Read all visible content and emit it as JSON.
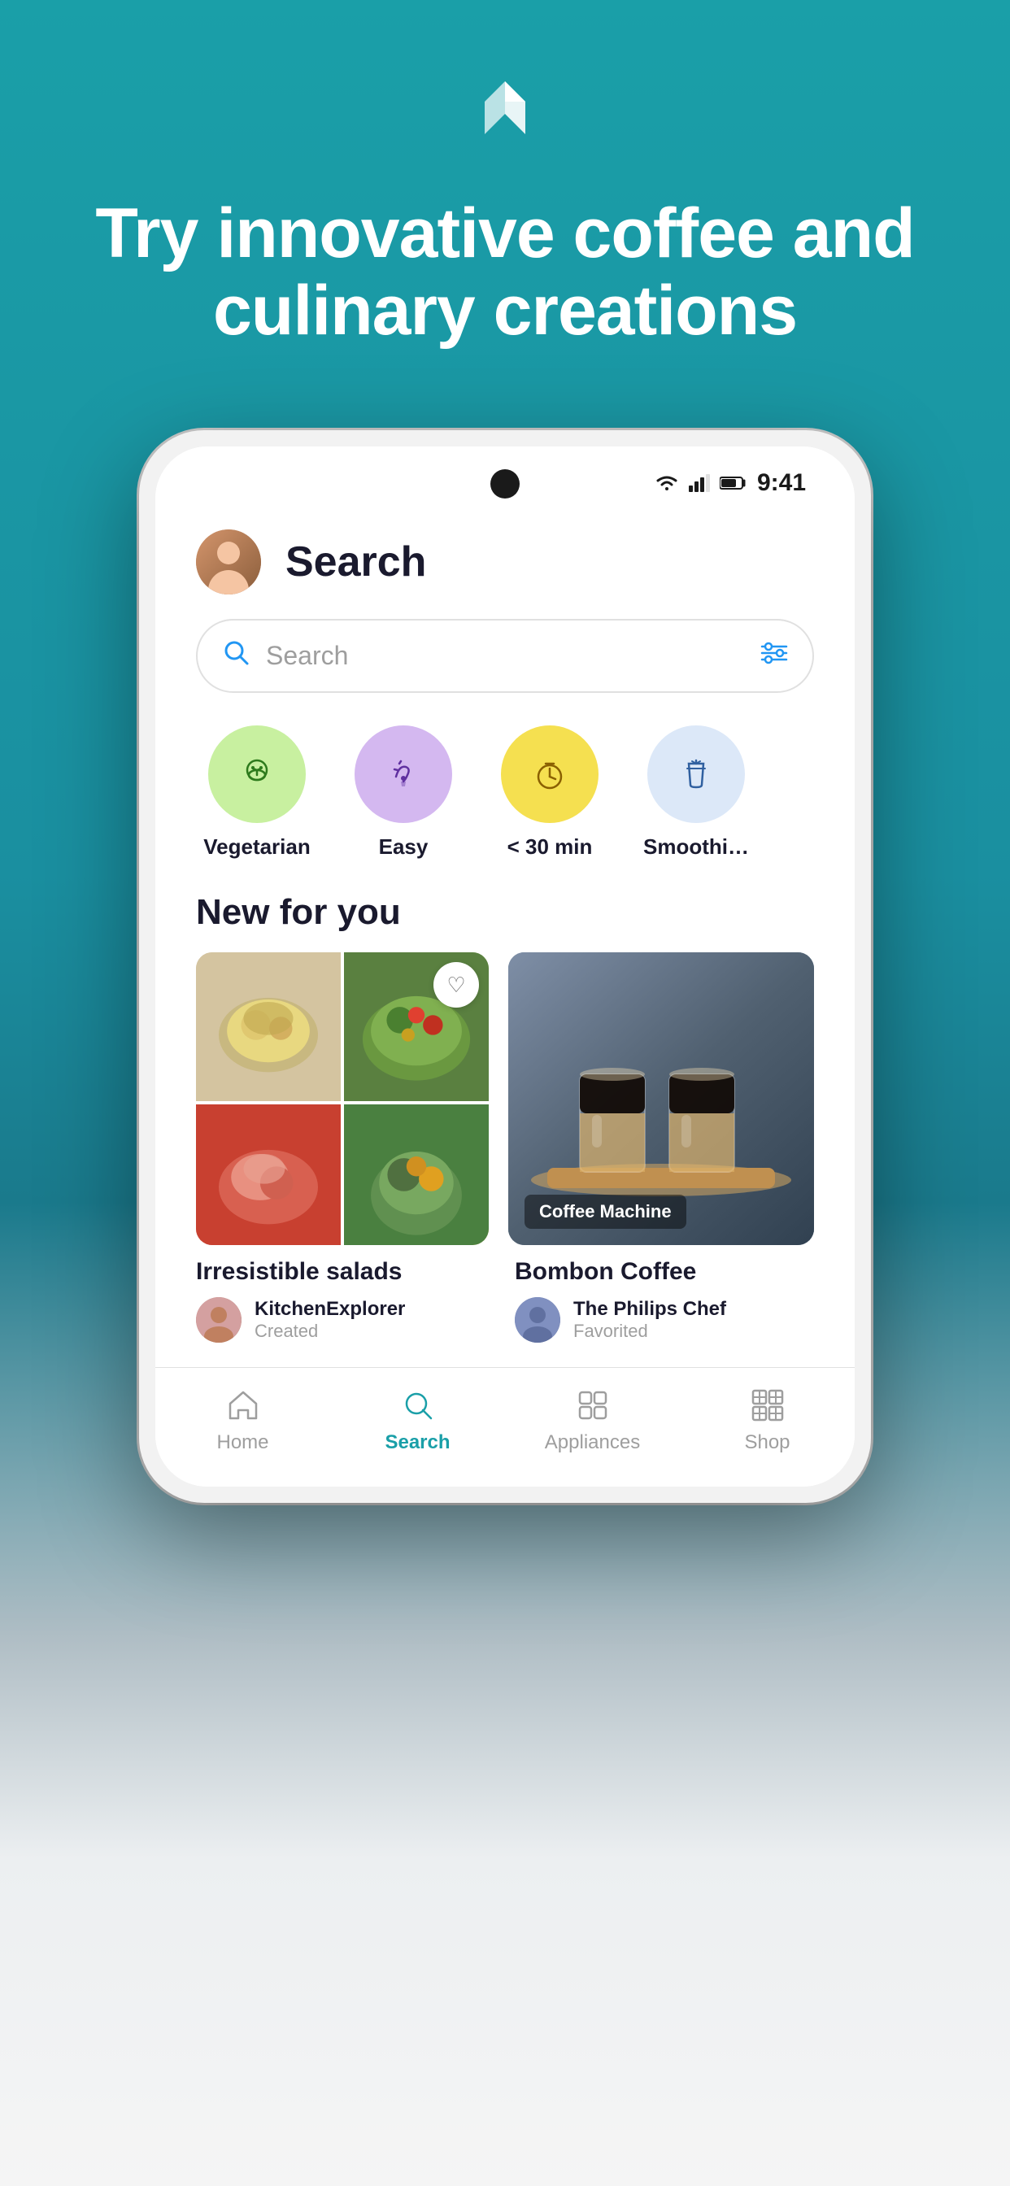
{
  "hero": {
    "title": "Try innovative coffee and culinary creations",
    "logo_alt": "App logo"
  },
  "status_bar": {
    "time": "9:41"
  },
  "page_header": {
    "title": "Search"
  },
  "search_bar": {
    "placeholder": "Search"
  },
  "categories": [
    {
      "id": "vegetarian",
      "label": "Vegetarian",
      "color_class": "cat-green",
      "emoji": "🥦"
    },
    {
      "id": "easy",
      "label": "Easy",
      "color_class": "cat-purple",
      "emoji": "👍"
    },
    {
      "id": "under30",
      "label": "< 30 min",
      "color_class": "cat-yellow",
      "emoji": "⏱"
    },
    {
      "id": "smoothie",
      "label": "Smoothi…",
      "color_class": "cat-lightblue",
      "emoji": "🥤"
    }
  ],
  "new_for_you": {
    "section_title": "New for you",
    "cards": [
      {
        "id": "salads",
        "title": "Irresistible salads",
        "author_name": "KitchenExplorer",
        "author_action": "Created"
      },
      {
        "id": "coffee",
        "title": "Bombon Coffee",
        "badge": "Coffee Machine",
        "author_name": "The Philips Chef",
        "author_action": "Favorited"
      }
    ]
  },
  "bottom_nav": {
    "items": [
      {
        "id": "home",
        "label": "Home",
        "active": false
      },
      {
        "id": "search",
        "label": "Search",
        "active": true
      },
      {
        "id": "appliances",
        "label": "Appliances",
        "active": false
      },
      {
        "id": "shop",
        "label": "Shop",
        "active": false
      }
    ]
  }
}
